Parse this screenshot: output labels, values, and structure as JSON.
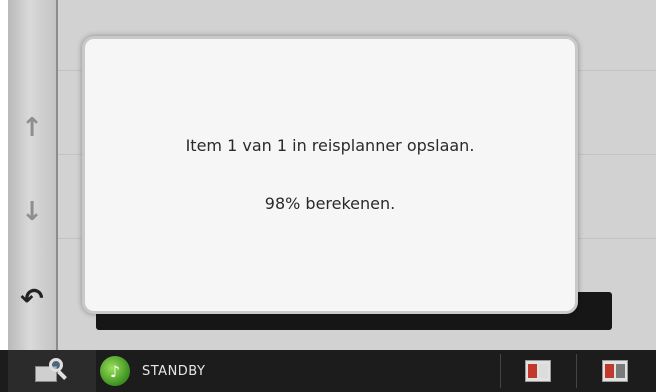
{
  "dialog": {
    "message_line1": "Item 1 van 1 in reisplanner opslaan.",
    "message_line2": "98% berekenen.",
    "progress_percent": 98
  },
  "sidebar": {
    "up_icon": "arrow-up-icon",
    "down_icon": "arrow-down-icon",
    "back_icon": "back-arrow-icon",
    "up_glyph": "↑",
    "down_glyph": "↓",
    "back_glyph": "↶"
  },
  "statusbar": {
    "standby_label": "STANDBY",
    "standby_glyph": "♪",
    "search_icon": "map-search-icon",
    "standby_icon": "audio-source-icon",
    "button1_icon": "screen-mode-icon",
    "button2_icon": "screen-split-icon"
  },
  "colors": {
    "dialog_background": "#f6f6f6",
    "background": "#d2d2d2",
    "statusbar": "#1c1c1c",
    "standby_green": "#4caf2a"
  }
}
